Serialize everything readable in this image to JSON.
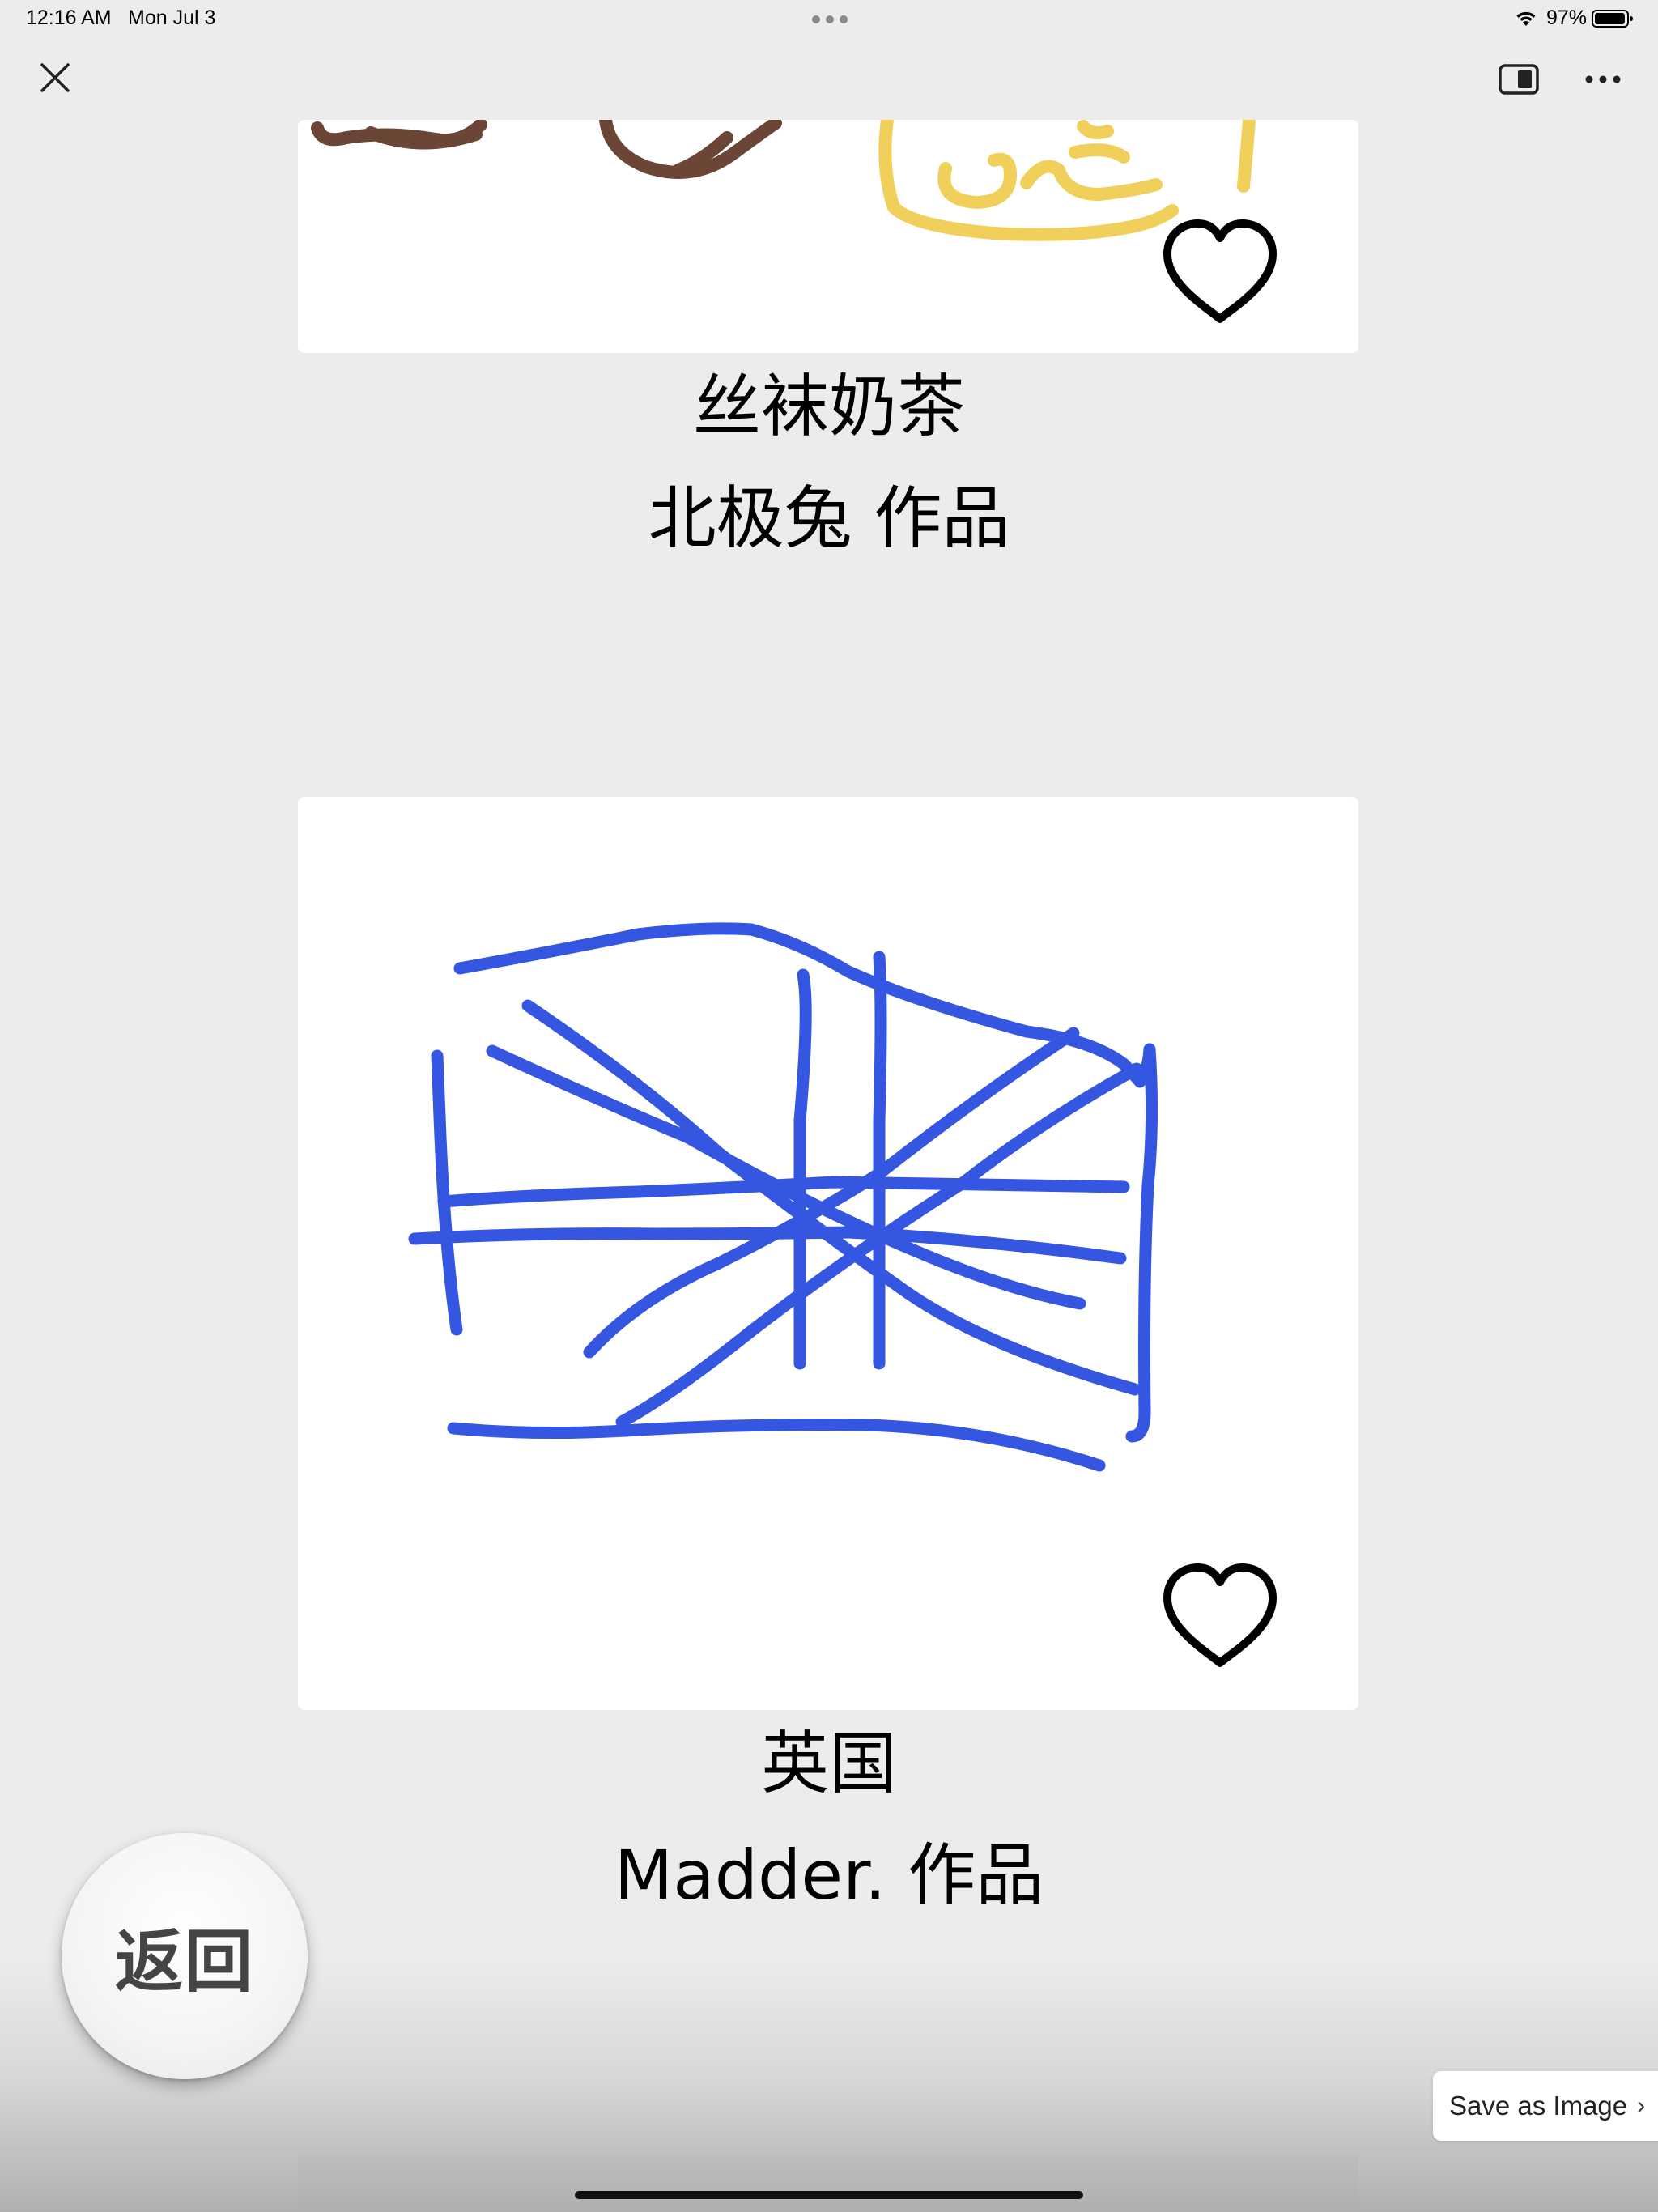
{
  "status_bar": {
    "time": "12:16 AM",
    "date": "Mon Jul 3",
    "battery_percent": "97%",
    "battery_level": 0.97
  },
  "toolbar": {
    "close_icon": "close-icon",
    "split_icon": "split-view-icon",
    "more_icon": "more-icon"
  },
  "gallery": {
    "items": [
      {
        "title": "丝袜奶茶",
        "author": "北极兔 作品",
        "liked": false,
        "stroke_colors": [
          "#6b4636",
          "#f1cf5b"
        ]
      },
      {
        "title": "英国",
        "author": "Madder. 作品",
        "liked": false,
        "stroke_colors": [
          "#3556e0"
        ]
      }
    ]
  },
  "back_button": {
    "label": "返回"
  },
  "save_image": {
    "label": "Save as Image",
    "chevron": "›"
  }
}
